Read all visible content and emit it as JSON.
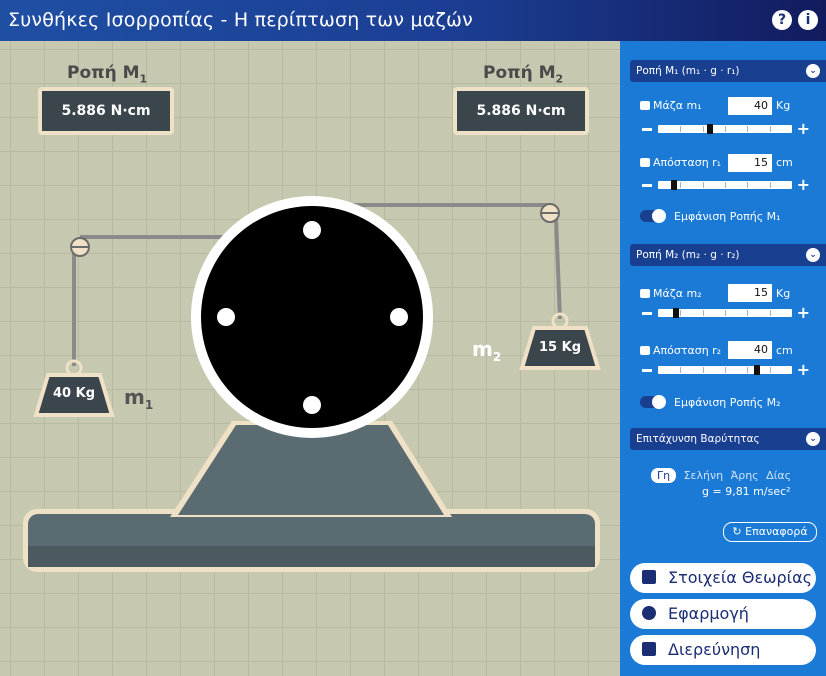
{
  "app": {
    "title": "Συνθήκες Ισορροπίας - Η περίπτωση των μαζών",
    "help_icon": "?",
    "info_icon": "i"
  },
  "stage": {
    "moment1": {
      "label": "Ροπή M",
      "sub": "1",
      "value": "5.886 N·cm"
    },
    "moment2": {
      "label": "Ροπή M",
      "sub": "2",
      "value": "5.886 N·cm"
    },
    "mass1": {
      "weight_label": "40 Kg",
      "name": "m",
      "sub": "1"
    },
    "mass2": {
      "weight_label": "15 Kg",
      "name": "m",
      "sub": "2"
    }
  },
  "panel": {
    "sec1": {
      "title": "Ροπή M₁ (m₁ · g · r₁)"
    },
    "mass1": {
      "label": "Μάζα m₁",
      "value": "40",
      "unit": "Kg",
      "slider_fraction": 0.38
    },
    "dist1": {
      "label": "Απόσταση r₁",
      "value": "15",
      "unit": "cm",
      "slider_fraction": 0.1
    },
    "toggle1": {
      "label": "Εμφάνιση Ροπής M₁"
    },
    "sec2": {
      "title": "Ροπή M₂ (m₂ · g · r₂)"
    },
    "mass2": {
      "label": "Μάζα m₂",
      "value": "15",
      "unit": "Kg",
      "slider_fraction": 0.12
    },
    "dist2": {
      "label": "Απόσταση r₂",
      "value": "40",
      "unit": "cm",
      "slider_fraction": 0.75
    },
    "toggle2": {
      "label": "Εμφάνιση Ροπής M₂"
    },
    "sec3": {
      "title": "Επιτάχυνση Βαρύτητας"
    },
    "gravity": {
      "options": [
        "Γη",
        "Σελήνη",
        "Άρης",
        "Δίας"
      ],
      "selected": "Γη",
      "value_text": "g = 9,81 m/sec²"
    },
    "reset_label": "Επαναφορά",
    "nav": [
      "Στοιχεία Θεωρίας",
      "Εφαρμογή",
      "Διερεύνηση"
    ]
  },
  "colors": {
    "title_bar": "#1f4fa3",
    "panel": "#1a7ad6",
    "section": "#193f91",
    "box": "#3a454c",
    "cream": "#efe1c6"
  }
}
